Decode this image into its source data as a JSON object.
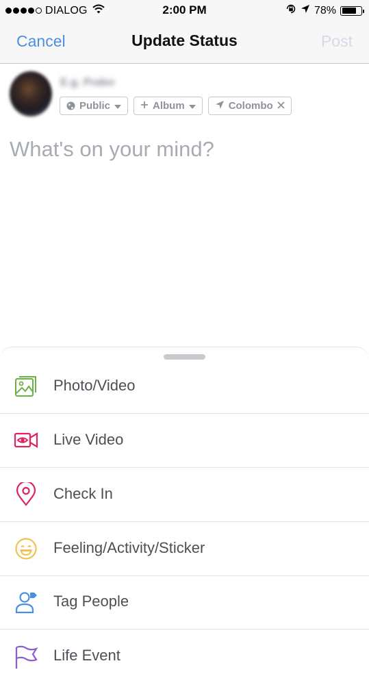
{
  "status_bar": {
    "carrier": "DIALOG",
    "time": "2:00 PM",
    "battery_percent": "78%",
    "battery_level": 0.78
  },
  "nav": {
    "cancel_label": "Cancel",
    "title": "Update Status",
    "post_label": "Post"
  },
  "composer": {
    "user_name": "E.g. Prabo",
    "chips": {
      "audience": "Public",
      "album": "Album",
      "location": "Colombo"
    },
    "placeholder": "What's on your mind?"
  },
  "actions": [
    {
      "label": "Photo/Video",
      "icon": "photo-icon",
      "color": "#6bb145"
    },
    {
      "label": "Live Video",
      "icon": "live-video-icon",
      "color": "#e0245e"
    },
    {
      "label": "Check In",
      "icon": "location-pin-icon",
      "color": "#e0245e"
    },
    {
      "label": "Feeling/Activity/Sticker",
      "icon": "smiley-icon",
      "color": "#f2c14e"
    },
    {
      "label": "Tag People",
      "icon": "tag-people-icon",
      "color": "#4a90e2"
    },
    {
      "label": "Life Event",
      "icon": "flag-icon",
      "color": "#8c5ad1"
    }
  ]
}
